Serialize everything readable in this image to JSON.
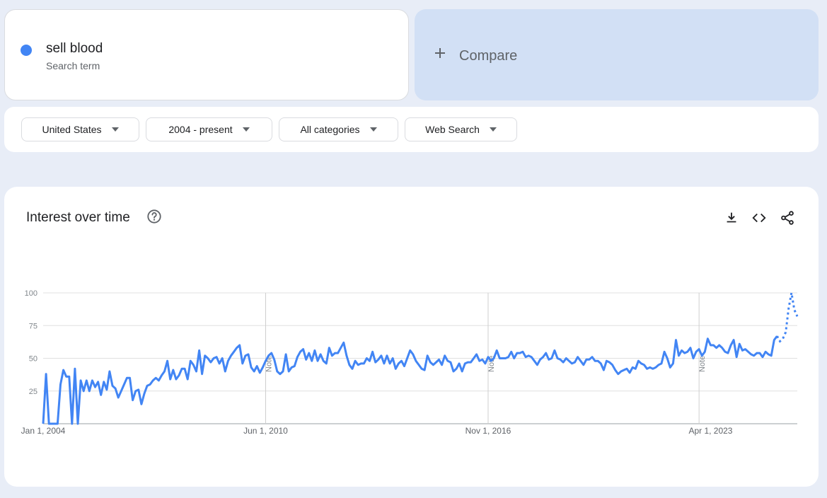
{
  "search_term": {
    "name": "sell blood",
    "subtitle": "Search term",
    "color": "#4285f4"
  },
  "compare": {
    "label": "Compare",
    "plus_icon": "plus-icon"
  },
  "filters": [
    {
      "label": "United States"
    },
    {
      "label": "2004 - present"
    },
    {
      "label": "All categories"
    },
    {
      "label": "Web Search"
    }
  ],
  "chart_card": {
    "title": "Interest over time",
    "help_icon": "help-circle-icon",
    "tools": [
      "download-icon",
      "embed-code-icon",
      "share-icon"
    ]
  },
  "chart_data": {
    "type": "line",
    "title": "",
    "xlabel": "",
    "ylabel": "",
    "ylim": [
      0,
      100
    ],
    "yticks": [
      25,
      50,
      75,
      100
    ],
    "grid": true,
    "x_start": "Jan 1, 2004",
    "x_end": "Apr 2025",
    "x_tick_labels": [
      "Jan 1, 2004",
      "Jun 1, 2010",
      "Nov 1, 2016",
      "Apr 1, 2023"
    ],
    "x_tick_positions_months": [
      0,
      77,
      154,
      231
    ],
    "notes": [
      {
        "label": "Note",
        "month": 77
      },
      {
        "label": "Note",
        "month": 154
      },
      {
        "label": "Note",
        "month": 227
      }
    ],
    "series": [
      {
        "name": "sell blood",
        "color": "#4285f4",
        "partial_from_index": 254,
        "values": [
          0,
          38,
          0,
          0,
          0,
          0,
          30,
          41,
          36,
          36,
          0,
          42,
          0,
          33,
          25,
          33,
          25,
          33,
          28,
          32,
          22,
          32,
          26,
          40,
          29,
          27,
          20,
          25,
          30,
          35,
          35,
          18,
          25,
          26,
          15,
          23,
          29,
          30,
          33,
          35,
          33,
          37,
          40,
          48,
          34,
          41,
          34,
          37,
          42,
          42,
          34,
          48,
          45,
          40,
          56,
          38,
          52,
          50,
          47,
          50,
          51,
          46,
          50,
          40,
          48,
          52,
          55,
          58,
          60,
          46,
          52,
          53,
          43,
          40,
          44,
          39,
          43,
          48,
          52,
          54,
          49,
          40,
          38,
          40,
          53,
          40,
          43,
          44,
          51,
          55,
          57,
          49,
          54,
          48,
          56,
          48,
          53,
          48,
          46,
          58,
          52,
          54,
          54,
          58,
          62,
          52,
          45,
          42,
          48,
          45,
          46,
          46,
          50,
          48,
          55,
          47,
          49,
          52,
          46,
          52,
          46,
          50,
          42,
          46,
          48,
          44,
          50,
          56,
          53,
          48,
          45,
          42,
          41,
          52,
          47,
          45,
          47,
          49,
          45,
          52,
          48,
          47,
          40,
          42,
          46,
          40,
          46,
          47,
          47,
          50,
          53,
          48,
          49,
          46,
          51,
          48,
          50,
          56,
          50,
          50,
          50,
          51,
          55,
          50,
          54,
          54,
          55,
          51,
          52,
          51,
          48,
          45,
          49,
          51,
          54,
          49,
          50,
          56,
          50,
          49,
          47,
          50,
          48,
          46,
          47,
          51,
          48,
          45,
          49,
          49,
          51,
          48,
          48,
          46,
          41,
          48,
          47,
          45,
          41,
          38,
          40,
          41,
          42,
          39,
          43,
          42,
          48,
          46,
          45,
          42,
          43,
          42,
          43,
          45,
          46,
          55,
          50,
          43,
          46,
          64,
          52,
          56,
          54,
          55,
          58,
          50,
          55,
          57,
          52,
          55,
          65,
          60,
          60,
          58,
          60,
          58,
          55,
          54,
          60,
          64,
          51,
          61,
          56,
          57,
          55,
          53,
          52,
          54,
          54,
          51,
          55,
          53,
          52,
          64,
          67,
          63,
          65,
          70,
          88,
          100,
          87,
          82
        ]
      }
    ]
  }
}
